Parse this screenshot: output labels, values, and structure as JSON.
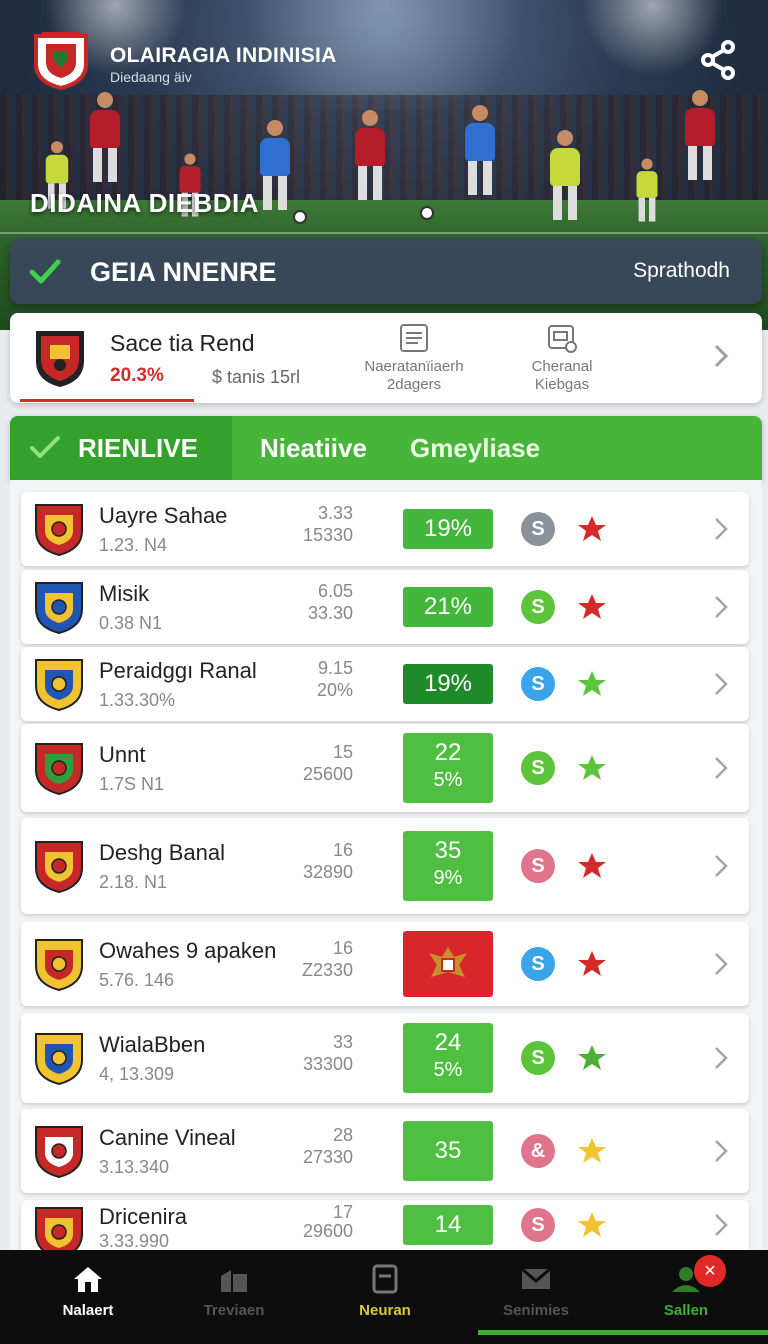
{
  "header": {
    "app_title": "OLAIRAGIA INDINISIA",
    "app_subtitle": "Diedaang äiv",
    "hero_caption": "DIDAINA DIEBDIA"
  },
  "status_bar": {
    "title": "GEIA NNENRE",
    "right_label": "Sprathodh"
  },
  "summary": {
    "team_name": "Sace tia Rend",
    "percent": "20.3%",
    "meta": "$ tanis 15rl",
    "action1_label": "Naeratanïiaerh 2dagers",
    "action2_label": "Cheranal Kiebgas"
  },
  "tabs": [
    {
      "label": "RIENLIVE",
      "active": true
    },
    {
      "label": "Nieatiive",
      "active": false
    },
    {
      "label": "Gmeyliase",
      "active": false
    }
  ],
  "rows": [
    {
      "name": "Uayre Sahae",
      "sub": "1.23. N4",
      "stat1": "3.33",
      "stat2": "15330",
      "pill": "19%",
      "pill2": "",
      "pill_color": "#43b73b",
      "coin_color": "#8a929c",
      "star_color": "#d42a2a"
    },
    {
      "name": "Misik",
      "sub": "0.38 N1",
      "stat1": "6.05",
      "stat2": "33.30",
      "pill": "21%",
      "pill2": "",
      "pill_color": "#43b73b",
      "coin_color": "#5bc43a",
      "star_color": "#d42a2a"
    },
    {
      "name": "Peraidggı Ranal",
      "sub": "1.33.30%",
      "stat1": "9.15",
      "stat2": "20%",
      "pill": "19%",
      "pill2": "",
      "pill_color": "#1f8a2a",
      "coin_color": "#3aa4ea",
      "star_color": "#5bc43a"
    },
    {
      "name": "Unnt",
      "sub": "1.7S N1",
      "stat1": "15",
      "stat2": "25600",
      "pill": "22",
      "pill2": "5%",
      "pill_color": "#4fbf42",
      "coin_color": "#5bc43a",
      "star_color": "#5bc43a"
    },
    {
      "name": "Deshg Banal",
      "sub": "2.18. N1",
      "stat1": "16",
      "stat2": "32890",
      "pill": "35",
      "pill2": "9%",
      "pill_color": "#4fbf42",
      "coin_color": "#e0748a",
      "star_color": "#d42a2a"
    },
    {
      "name": "Owahes 9 apaken",
      "sub": "5.76. 146",
      "stat1": "16",
      "stat2": "Z2330",
      "pill": "",
      "pill2": "",
      "pill_color": "#d8262a",
      "coin_color": "#3aa4ea",
      "star_color": "#d42a2a"
    },
    {
      "name": "WialaBben",
      "sub": "4, 13.309",
      "stat1": "33",
      "stat2": "33300",
      "pill": "24",
      "pill2": "5%",
      "pill_color": "#4fbf42",
      "coin_color": "#5bc43a",
      "star_color": "#4caf3a"
    },
    {
      "name": "Canine Vineal",
      "sub": "3.13.340",
      "stat1": "28",
      "stat2": "27330",
      "pill": "35",
      "pill2": "",
      "pill_color": "#4fbf42",
      "coin_color": "#e0748a",
      "star_color": "#f1c232"
    },
    {
      "name": "Dricenira",
      "sub": "3.33.990",
      "stat1": "17",
      "stat2": "29600",
      "pill": "14",
      "pill2": "",
      "pill_color": "#4fbf42",
      "coin_color": "#e0748a",
      "star_color": "#f1c232"
    }
  ],
  "coin_glyph": "S",
  "coin_glyph_alt": "&",
  "bottom_nav": [
    {
      "label": "Nalaert",
      "icon": "home-icon",
      "color": "#ffffff"
    },
    {
      "label": "Treviaen",
      "icon": "buildings-icon",
      "color": "#555555"
    },
    {
      "label": "Neuran",
      "icon": "news-icon",
      "color": "#d7c93a"
    },
    {
      "label": "Senimies",
      "icon": "mail-icon",
      "color": "#555555"
    },
    {
      "label": "Sallen",
      "icon": "profile-icon",
      "color": "#3fae35"
    }
  ],
  "badge": "×",
  "colors": {
    "accent_green": "#43b73b",
    "accent_red": "#d22b2b",
    "status_bg": "#3a475c"
  }
}
